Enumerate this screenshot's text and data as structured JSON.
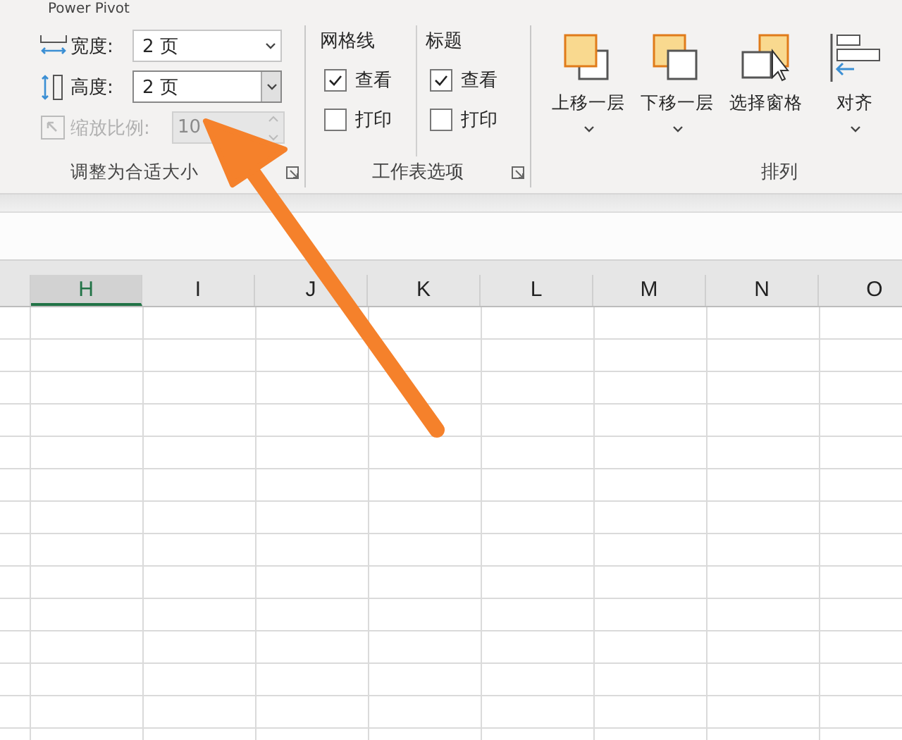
{
  "tabs": [
    {
      "label": "Power Pivot"
    }
  ],
  "ribbon": {
    "groups": [
      {
        "kind": "fit",
        "title": "调整为合适大小",
        "fields": [
          {
            "kind": "width",
            "label": "宽度:",
            "value": "2 页",
            "focused": false,
            "disabled": false
          },
          {
            "kind": "height",
            "label": "高度:",
            "value": "2 页",
            "focused": true,
            "disabled": false
          },
          {
            "kind": "scale",
            "label": "缩放比例:",
            "value": "10",
            "focused": false,
            "disabled": true
          }
        ]
      },
      {
        "kind": "options",
        "title": "工作表选项",
        "columns": [
          {
            "heading": "网格线",
            "options": [
              {
                "label": "查看",
                "checked": true
              },
              {
                "label": "打印",
                "checked": false
              }
            ]
          },
          {
            "heading": "标题",
            "options": [
              {
                "label": "查看",
                "checked": true
              },
              {
                "label": "打印",
                "checked": false
              }
            ]
          }
        ]
      },
      {
        "kind": "arrange",
        "title": "排列",
        "buttons": [
          {
            "kind": "bring-forward",
            "label": "上移一层",
            "dropdown": true
          },
          {
            "kind": "send-backward",
            "label": "下移一层",
            "dropdown": true
          },
          {
            "kind": "selection-pane",
            "label": "选择窗格",
            "dropdown": false
          },
          {
            "kind": "align",
            "label": "对齐",
            "dropdown": true
          }
        ]
      }
    ]
  },
  "sheet": {
    "columns": [
      {
        "label": "H",
        "selected": true
      },
      {
        "label": "I",
        "selected": false
      },
      {
        "label": "J",
        "selected": false
      },
      {
        "label": "K",
        "selected": false
      },
      {
        "label": "L",
        "selected": false
      },
      {
        "label": "M",
        "selected": false
      },
      {
        "label": "N",
        "selected": false
      },
      {
        "label": "O",
        "selected": false
      }
    ]
  }
}
